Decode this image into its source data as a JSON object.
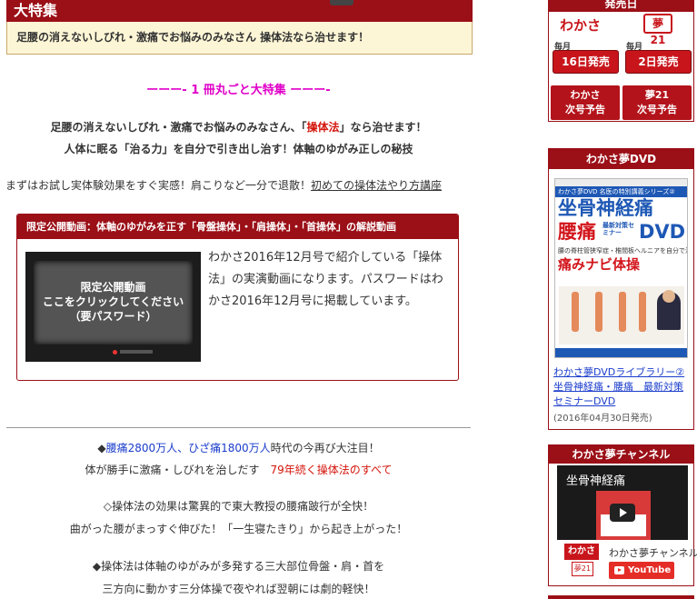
{
  "feature": {
    "title": "大特集",
    "subtitle": "足腰の消えないしびれ・激痛でお悩みのみなさん 操体法なら治せます！"
  },
  "article": {
    "section_heading": "ーーー- 1 冊丸ごと大特集 ーーー-",
    "lead1_a": "足腰の消えないしびれ・激痛でお悩みのみなさん、「",
    "lead1_red": "操体法",
    "lead1_b": "」なら治せます！",
    "lead2": "人体に眠る「治る力」を自分で引き出し治す！体軸のゆがみ正しの秘技",
    "trial_text": "まずはお試し実体験効果をすぐ実感！肩こりなど一分で退散！",
    "trial_link": "初めての操体法やり方講座"
  },
  "video_box": {
    "header": "限定公開動画：体軸のゆがみを正す「骨盤操体」・「肩操体」・「首操体」の解説動画",
    "thumb_line1": "限定公開動画",
    "thumb_line2": "ここをクリックしてください",
    "thumb_line3": "（要パスワード）",
    "description": "わかさ2016年12月号で紹介している「操体法」の実演動画になります。パスワードはわかさ2016年12月号に掲載しています。"
  },
  "bullets": {
    "b1_prefix": "◆",
    "b1_blue": "腰痛2800万人、ひざ痛1800万人",
    "b1_suffix": "時代の今再び大注目！",
    "b1_line2_a": "体が勝手に激痛・しびれを治しだす　",
    "b1_line2_red": "79年続く操体法のすべて",
    "b2_line1": "◇操体法の効果は驚異的で東大教授の腰痛跛行が全快！",
    "b2_line2": "曲がった腰がまっすぐ伸びた！「一生寝たきり」から起き上がった！",
    "b3_line1": "◆操体法は体軸のゆがみが多発する三大部位骨盤・肩・首を",
    "b3_line2": "三方向に動かす三分体操で夜やれば翌朝には劇的軽快！"
  },
  "sidebar": {
    "release": {
      "header": "発売日",
      "wakasa_logo": "わかさ",
      "yume_logo": "夢21",
      "monthly1": "毎月",
      "monthly2": "毎月",
      "date1": "16日発売",
      "date2": "2日発売",
      "next1_a": "わかさ",
      "next1_b": "次号予告",
      "next2_a": "夢21",
      "next2_b": "次号予告"
    },
    "dvd": {
      "header": "わかさ夢DVD",
      "cover_band": "わかさ夢DVD 名医の特別講義シリーズ②",
      "cover_big1": "坐骨神経痛",
      "cover_big2a": "腰痛",
      "cover_big2b": "最新対策セミナー",
      "cover_big2c": "DVD",
      "cover_small1": "腰の脊柱管狭窄症・椎間板ヘルニアを自分で治す",
      "cover_big3": "痛みナビ体操",
      "link": "わかさ夢DVDライブラリー② 坐骨神経痛・腰痛　最新対策セミナーDVD",
      "date": "(2016年04月30日発売)"
    },
    "channel": {
      "header": "わかさ夢チャンネル",
      "video_title": "坐骨神経痛",
      "logo_a": "わかさ",
      "logo_b": "夢21",
      "channel_name": "わかさ夢チャンネル",
      "youtube_label": "YouTube"
    }
  },
  "colors": {
    "brand_red": "#9b0f17",
    "highlight_magenta": "#e000c8",
    "link_blue": "#1a3ccc",
    "accent_red": "#d4150b"
  }
}
